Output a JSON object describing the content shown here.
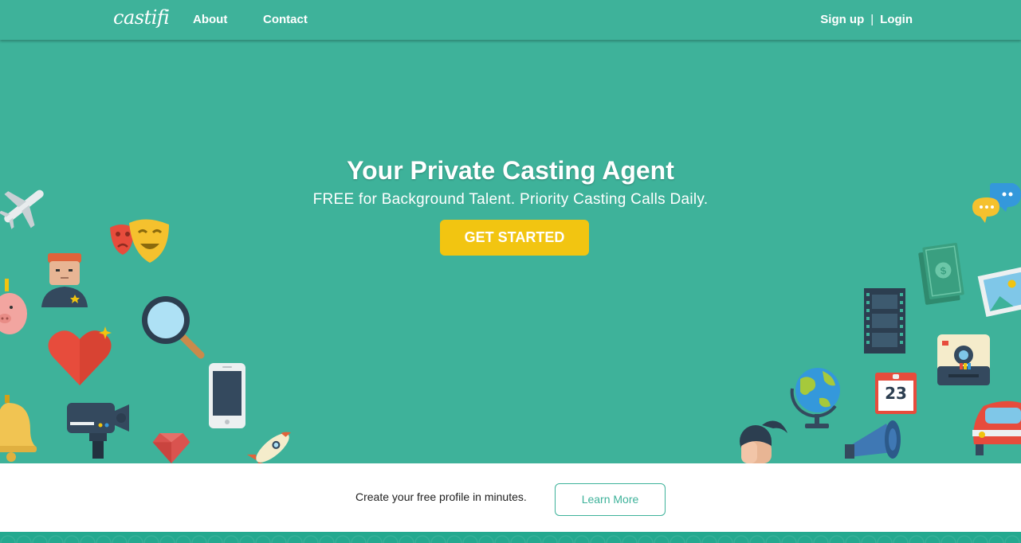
{
  "nav": {
    "logo": "castifi",
    "about": "About",
    "contact": "Contact",
    "signup": "Sign up",
    "separator": "|",
    "login": "Login"
  },
  "hero": {
    "title": "Your Private Casting Agent",
    "subtitle": "FREE for Background Talent. Priority Casting Calls Daily.",
    "cta": "GET STARTED"
  },
  "calendar_day": "23",
  "band": {
    "text": "Create your free profile in minutes.",
    "button": "Learn More"
  },
  "colors": {
    "primary": "#3eb29a",
    "cta": "#f2c511",
    "white": "#ffffff"
  },
  "icons": [
    "airplane-icon",
    "theater-masks-icon",
    "officer-icon",
    "piggy-bank-icon",
    "magnifier-icon",
    "heart-icon",
    "smartphone-icon",
    "bell-icon",
    "camera-icon",
    "gem-icon",
    "rocket-icon",
    "chat-bubbles-icon",
    "money-icon",
    "photos-icon",
    "film-strip-icon",
    "instant-camera-icon",
    "globe-icon",
    "calendar-icon",
    "car-icon",
    "woman-icon",
    "megaphone-icon"
  ]
}
